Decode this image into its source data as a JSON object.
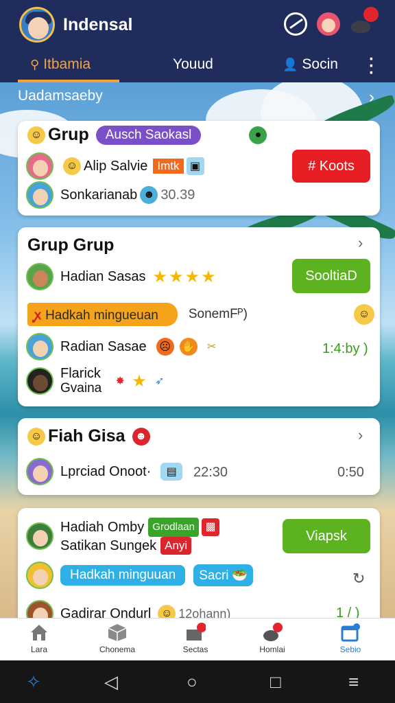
{
  "header": {
    "title": "Indensal",
    "icons": [
      "ball-icon",
      "profile-icon",
      "mouse-icon"
    ]
  },
  "tabs": [
    {
      "label": "Itbamia",
      "icon": "search-icon",
      "active": true
    },
    {
      "label": "Youud",
      "active": false
    },
    {
      "label": "Socin",
      "icon": "person-icon",
      "active": false
    }
  ],
  "section": {
    "label": "Uadamsaeby"
  },
  "card1": {
    "title": "Grup",
    "badge": "Ausch Saokasl",
    "row1_name": "Alip Salvie",
    "row1_tag": "Imtk",
    "row2_name": "Sonkarianab",
    "row2_value": "30.39",
    "action_label": "# Koots"
  },
  "card2": {
    "title": "Grup Grup",
    "row1_name": "Hadian Sasas",
    "row1_stars": 4,
    "pill_label": "Hadkah mingueuan",
    "pill_side_text": "SonemFᴾ)",
    "row3_name": "Radian Sasae",
    "row3_time": "1:4:by )",
    "row4_name_line1": "Flarick",
    "row4_name_line2": "Gvaina",
    "action_label": "SooltiaD"
  },
  "card3": {
    "title": "Fiah Gisa",
    "row_name": "Lprciad Onoot·",
    "row_time": "22:30",
    "row_duration": "0:50"
  },
  "card4": {
    "row1_name": "Hadiah Omby",
    "row1_tag": "Grodlaan",
    "row2_name": "Satikan Sungek",
    "row2_tag": "Anyi",
    "pill_label": "Hadkah minguuan",
    "pill2_label": "Sacri",
    "row4_name": "Gadirar Ondurl",
    "row4_value": "12ohann)",
    "row4_time": "1 / )",
    "action_label": "Viapsk"
  },
  "bottom_nav": [
    {
      "label": "Lara",
      "icon": "home-icon"
    },
    {
      "label": "Chonema",
      "icon": "box-icon"
    },
    {
      "label": "Sectas",
      "icon": "cards-icon"
    },
    {
      "label": "Homlai",
      "icon": "mouse-icon"
    },
    {
      "label": "Sebio",
      "icon": "calendar-icon",
      "active": true
    }
  ],
  "colors": {
    "header_bg": "#1f2c5c",
    "tab_active": "#f5a235",
    "red_button": "#e61e24",
    "green_button": "#5cb31f",
    "purple_badge": "#7b4fc8",
    "orange_pill": "#f5a31a",
    "blue_pill": "#2eb0e6"
  }
}
